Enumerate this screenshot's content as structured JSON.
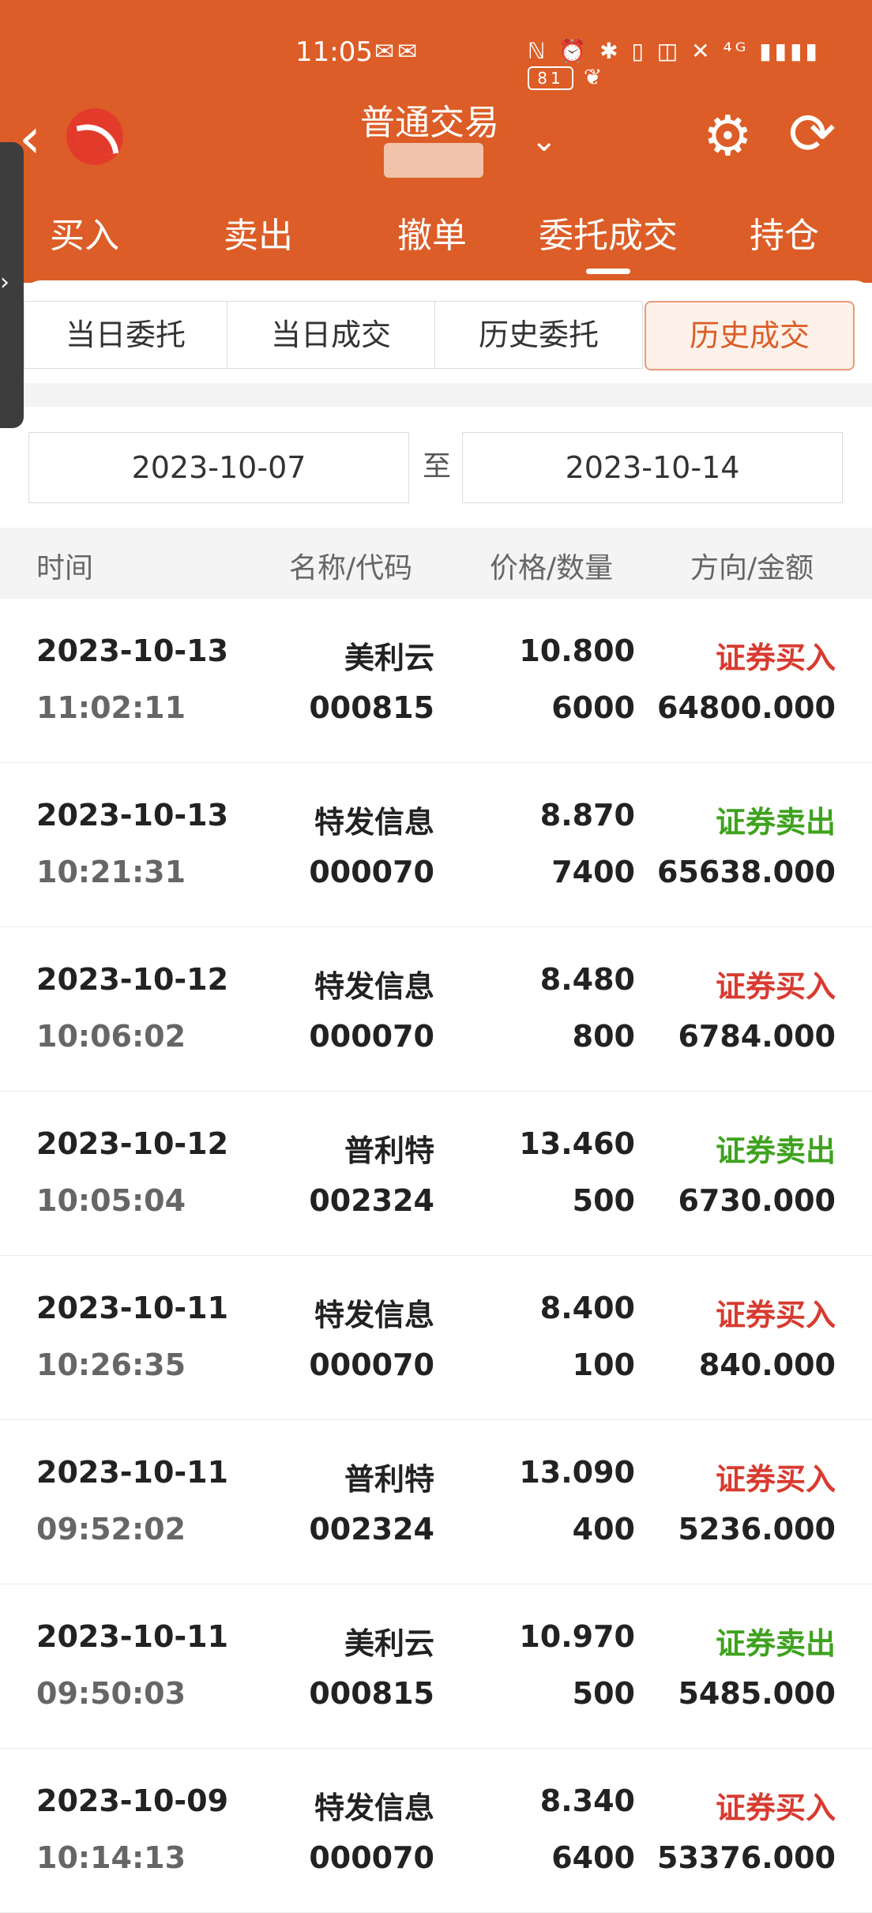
{
  "status_bar": {
    "time": "11:05",
    "battery": "81",
    "icons": "ℕ ⏰ ✱ ▯ ◫ ✕ ⁴ᴳ ▮▮▮▮"
  },
  "header": {
    "title": "普通交易",
    "subtitle": "▒▒▒▒",
    "tabs": [
      "买入",
      "卖出",
      "撤单",
      "委托成交",
      "持仓"
    ],
    "active_tab": "委托成交"
  },
  "segments": {
    "items": [
      "当日委托",
      "当日成交",
      "历史委托",
      "历史成交"
    ],
    "active": "历史成交"
  },
  "date_range": {
    "start": "2023-10-07",
    "separator": "至",
    "end": "2023-10-14"
  },
  "table": {
    "columns": [
      "时间",
      "名称/代码",
      "价格/数量",
      "方向/金额"
    ],
    "rows": [
      {
        "date": "2023-10-13",
        "time": "11:02:11",
        "name": "美利云",
        "code": "000815",
        "price": "10.800",
        "qty": "6000",
        "direction": "证券买入",
        "amount": "64800.000",
        "side": "buy"
      },
      {
        "date": "2023-10-13",
        "time": "10:21:31",
        "name": "特发信息",
        "code": "000070",
        "price": "8.870",
        "qty": "7400",
        "direction": "证券卖出",
        "amount": "65638.000",
        "side": "sell"
      },
      {
        "date": "2023-10-12",
        "time": "10:06:02",
        "name": "特发信息",
        "code": "000070",
        "price": "8.480",
        "qty": "800",
        "direction": "证券买入",
        "amount": "6784.000",
        "side": "buy"
      },
      {
        "date": "2023-10-12",
        "time": "10:05:04",
        "name": "普利特",
        "code": "002324",
        "price": "13.460",
        "qty": "500",
        "direction": "证券卖出",
        "amount": "6730.000",
        "side": "sell"
      },
      {
        "date": "2023-10-11",
        "time": "10:26:35",
        "name": "特发信息",
        "code": "000070",
        "price": "8.400",
        "qty": "100",
        "direction": "证券买入",
        "amount": "840.000",
        "side": "buy"
      },
      {
        "date": "2023-10-11",
        "time": "09:52:02",
        "name": "普利特",
        "code": "002324",
        "price": "13.090",
        "qty": "400",
        "direction": "证券买入",
        "amount": "5236.000",
        "side": "buy"
      },
      {
        "date": "2023-10-11",
        "time": "09:50:03",
        "name": "美利云",
        "code": "000815",
        "price": "10.970",
        "qty": "500",
        "direction": "证券卖出",
        "amount": "5485.000",
        "side": "sell"
      },
      {
        "date": "2023-10-09",
        "time": "10:14:13",
        "name": "特发信息",
        "code": "000070",
        "price": "8.340",
        "qty": "6400",
        "direction": "证券买入",
        "amount": "53376.000",
        "side": "buy"
      }
    ]
  },
  "colors": {
    "header": "#dc5d27",
    "buy": "#d83b30",
    "sell": "#3fa21f"
  },
  "icons": {
    "back": "back-icon",
    "logo": "app-logo-icon",
    "dropdown": "chevron-down-icon",
    "settings": "gear-icon",
    "refresh": "refresh-icon",
    "side": "chevron-right-icon"
  }
}
